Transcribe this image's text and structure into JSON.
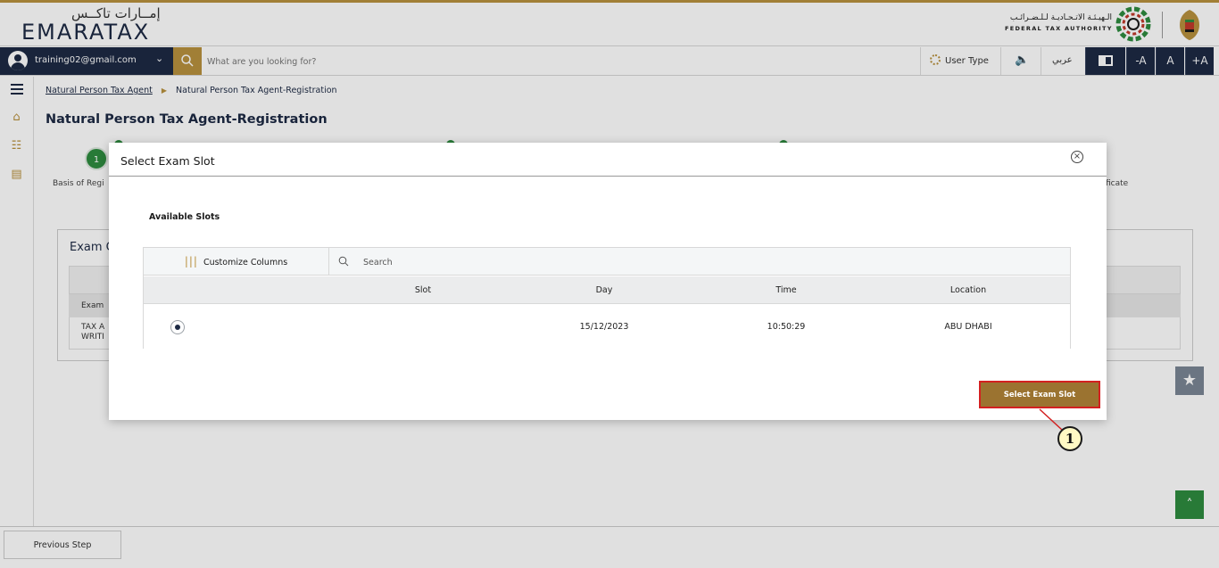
{
  "brand": {
    "logo_arabic": "إمــارات تاكــس",
    "logo_english": "EMARATAX",
    "authority_arabic": "الـهيـئـة الاتـحـاديـة لـلـضـرائـب",
    "authority_english": "FEDERAL TAX AUTHORITY"
  },
  "toolbar": {
    "user_email": "training02@gmail.com",
    "search_placeholder": "What are you looking for?",
    "user_type_label": "User Type",
    "arabic_label": "عربي",
    "font_decrease": "-A",
    "font_normal": "A",
    "font_increase": "+A"
  },
  "breadcrumb": {
    "parent": "Natural Person Tax Agent",
    "current": "Natural Person Tax Agent-Registration"
  },
  "page": {
    "title": "Natural Person Tax Agent-Registration",
    "step_number": "1",
    "step_label_partial": "Basis of Regi",
    "step_label_right_partial": "ficate",
    "exam_card_title_partial": "Exam C",
    "exam_col_partial": "Exam",
    "exam_row_line1": "TAX A",
    "exam_row_line2": "WRITI"
  },
  "modal": {
    "title": "Select Exam Slot",
    "section_label": "Available Slots",
    "customize_columns": "Customize Columns",
    "search_placeholder": "Search",
    "columns": [
      "Slot",
      "Day",
      "Time",
      "Location"
    ],
    "rows": [
      {
        "slot": "",
        "day": "15/12/2023",
        "time": "10:50:29",
        "location": "ABU DHABI",
        "selected": true
      }
    ],
    "confirm_button": "Select Exam Slot"
  },
  "footer": {
    "previous_step": "Previous Step"
  },
  "annotation": {
    "callout_number": "1"
  },
  "colors": {
    "navy": "#1d2a44",
    "gold": "#b8913e",
    "button_brown": "#9b7330",
    "highlight_red": "#d32020",
    "step_green": "#2e8b3f"
  }
}
